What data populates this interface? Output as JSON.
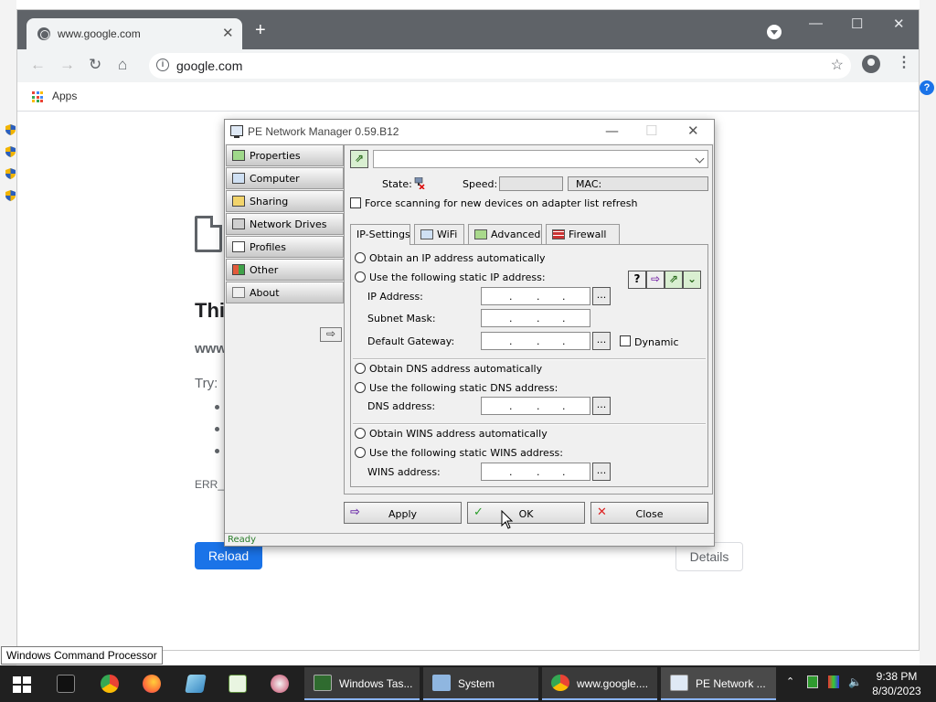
{
  "colors": {
    "taskbar": "#202020",
    "chrome_tabstrip": "#5f6368",
    "reload_blue": "#1a73e8",
    "status_green": "#2a7d2a"
  },
  "chrome": {
    "tab_title": "www.google.com",
    "url": "google.com",
    "bookmarks": {
      "apps_label": "Apps"
    },
    "icons": [
      "back-arrow-icon",
      "forward-arrow-icon",
      "reload-icon",
      "home-icon",
      "info-icon",
      "star-icon",
      "profile-icon",
      "more-vert-icon"
    ]
  },
  "error_page": {
    "heading_fragment": "Thi",
    "host_fragment": "www",
    "try_label": "Try:",
    "code_fragment": "ERR_N",
    "reload_label": "Reload",
    "details_label": "Details"
  },
  "pe": {
    "title": "PE Network Manager 0.59.B12",
    "sidebar": [
      {
        "label": "Properties",
        "icon": "network-card-icon"
      },
      {
        "label": "Computer",
        "icon": "computer-icon"
      },
      {
        "label": "Sharing",
        "icon": "folder-share-icon"
      },
      {
        "label": "Network Drives",
        "icon": "network-drive-icon"
      },
      {
        "label": "Profiles",
        "icon": "profiles-icon"
      },
      {
        "label": "Other",
        "icon": "other-grid-icon"
      },
      {
        "label": "About",
        "icon": "help-icon"
      }
    ],
    "state_label": "State:",
    "speed_label": "Speed:",
    "mac_label": "MAC:",
    "force_scan_label": "Force scanning for new devices on adapter list refresh",
    "tabs": [
      {
        "label": "IP-Settings"
      },
      {
        "label": "WiFi"
      },
      {
        "label": "Advanced"
      },
      {
        "label": "Firewall"
      }
    ],
    "ip": {
      "obtain_auto": "Obtain an IP address automatically",
      "use_static": "Use the following static IP address:",
      "ip_address_label": "IP Address:",
      "subnet_label": "Subnet Mask:",
      "gateway_label": "Default Gateway:",
      "dynamic_label": "Dynamic"
    },
    "dns": {
      "obtain_auto": "Obtain DNS address automatically",
      "use_static": "Use the following static DNS address:",
      "dns_label": "DNS address:"
    },
    "wins": {
      "obtain_auto": "Obtain WINS address automatically",
      "use_static": "Use the following static WINS address:",
      "wins_label": "WINS address:"
    },
    "ellipsis": "...",
    "buttons": {
      "apply": "Apply",
      "ok": "OK",
      "close": "Close"
    },
    "status": "Ready"
  },
  "tooltip": "Windows Command Processor",
  "taskbar": {
    "tasks": [
      {
        "label": "Windows Tas..."
      },
      {
        "label": "System"
      },
      {
        "label": "www.google...."
      },
      {
        "label": "PE Network ..."
      }
    ],
    "time": "9:38 PM",
    "date": "8/30/2023"
  }
}
